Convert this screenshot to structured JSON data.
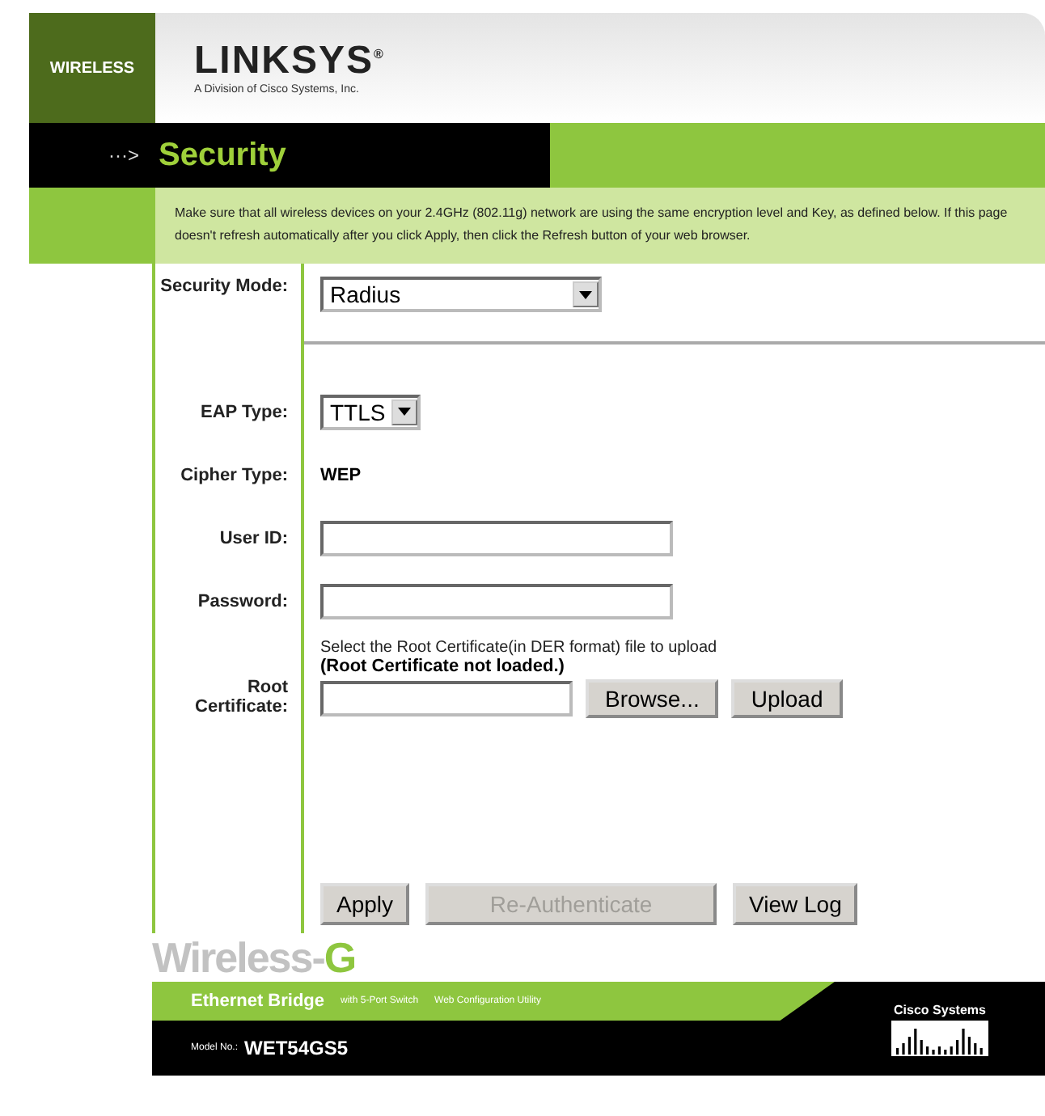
{
  "header": {
    "section_tab": "WIRELESS",
    "brand": "LINKSYS",
    "brand_mark": "®",
    "tagline": "A Division of Cisco Systems, Inc."
  },
  "title_bar": {
    "arrow": "···>",
    "title": "Security"
  },
  "info": "Make sure that all wireless devices on your 2.4GHz (802.11g) network are using the same encryption level and Key, as defined below. If this page doesn't refresh automatically after you click Apply, then click the Refresh button of your web browser.",
  "security_mode": {
    "label": "Security Mode:",
    "value": "Radius"
  },
  "fields": [
    {
      "kind": "select",
      "label": "EAP Type:",
      "value": "TTLS"
    },
    {
      "kind": "static",
      "label": "Cipher Type:",
      "value": "WEP"
    },
    {
      "kind": "input",
      "label": "User ID:"
    },
    {
      "kind": "input",
      "label": "Password:"
    }
  ],
  "root_certificate": {
    "label": "Root Certificate:",
    "hint": "Select the Root Certificate(in DER format) file to upload",
    "status": "(Root Certificate not loaded.)",
    "browse": "Browse...",
    "upload": "Upload"
  },
  "buttons": [
    {
      "label": "Apply",
      "disabled": false
    },
    {
      "label": "Re-Authenticate",
      "disabled": true
    },
    {
      "label": "View Log",
      "disabled": false
    }
  ],
  "footer": {
    "product": "Wireless-",
    "product_accent": "G",
    "device": "Ethernet Bridge",
    "device_detail": "with 5-Port Switch",
    "utility": "Web Configuration Utility",
    "model_label": "Model No.:",
    "model": "WET54GS5",
    "cisco": "Cisco Systems"
  }
}
